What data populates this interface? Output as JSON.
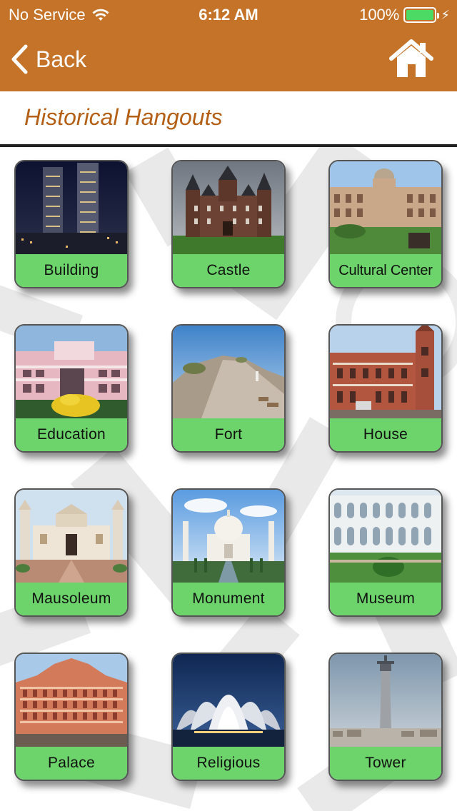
{
  "status_bar": {
    "carrier": "No Service",
    "time": "6:12 AM",
    "battery": "100%"
  },
  "nav": {
    "back_label": "Back"
  },
  "page": {
    "title": "Historical Hangouts"
  },
  "categories": [
    {
      "label": "Building",
      "image": "skyscrapers-night"
    },
    {
      "label": "Castle",
      "image": "castle"
    },
    {
      "label": "Cultural Center",
      "image": "heritage-building-lawn"
    },
    {
      "label": "Education",
      "image": "college-building"
    },
    {
      "label": "Fort",
      "image": "hill-fort"
    },
    {
      "label": "House",
      "image": "red-brick-mansion"
    },
    {
      "label": "Mausoleum",
      "image": "itimad-ud-daulah"
    },
    {
      "label": "Monument",
      "image": "taj-mahal"
    },
    {
      "label": "Museum",
      "image": "museum-courtyard"
    },
    {
      "label": "Palace",
      "image": "hawa-mahal"
    },
    {
      "label": "Religious",
      "image": "lotus-temple"
    },
    {
      "label": "Tower",
      "image": "tower-skyline"
    }
  ],
  "colors": {
    "header": "#c57328",
    "title": "#b45f15",
    "label_bg": "#6cd46a",
    "battery_fill": "#4cd964"
  }
}
